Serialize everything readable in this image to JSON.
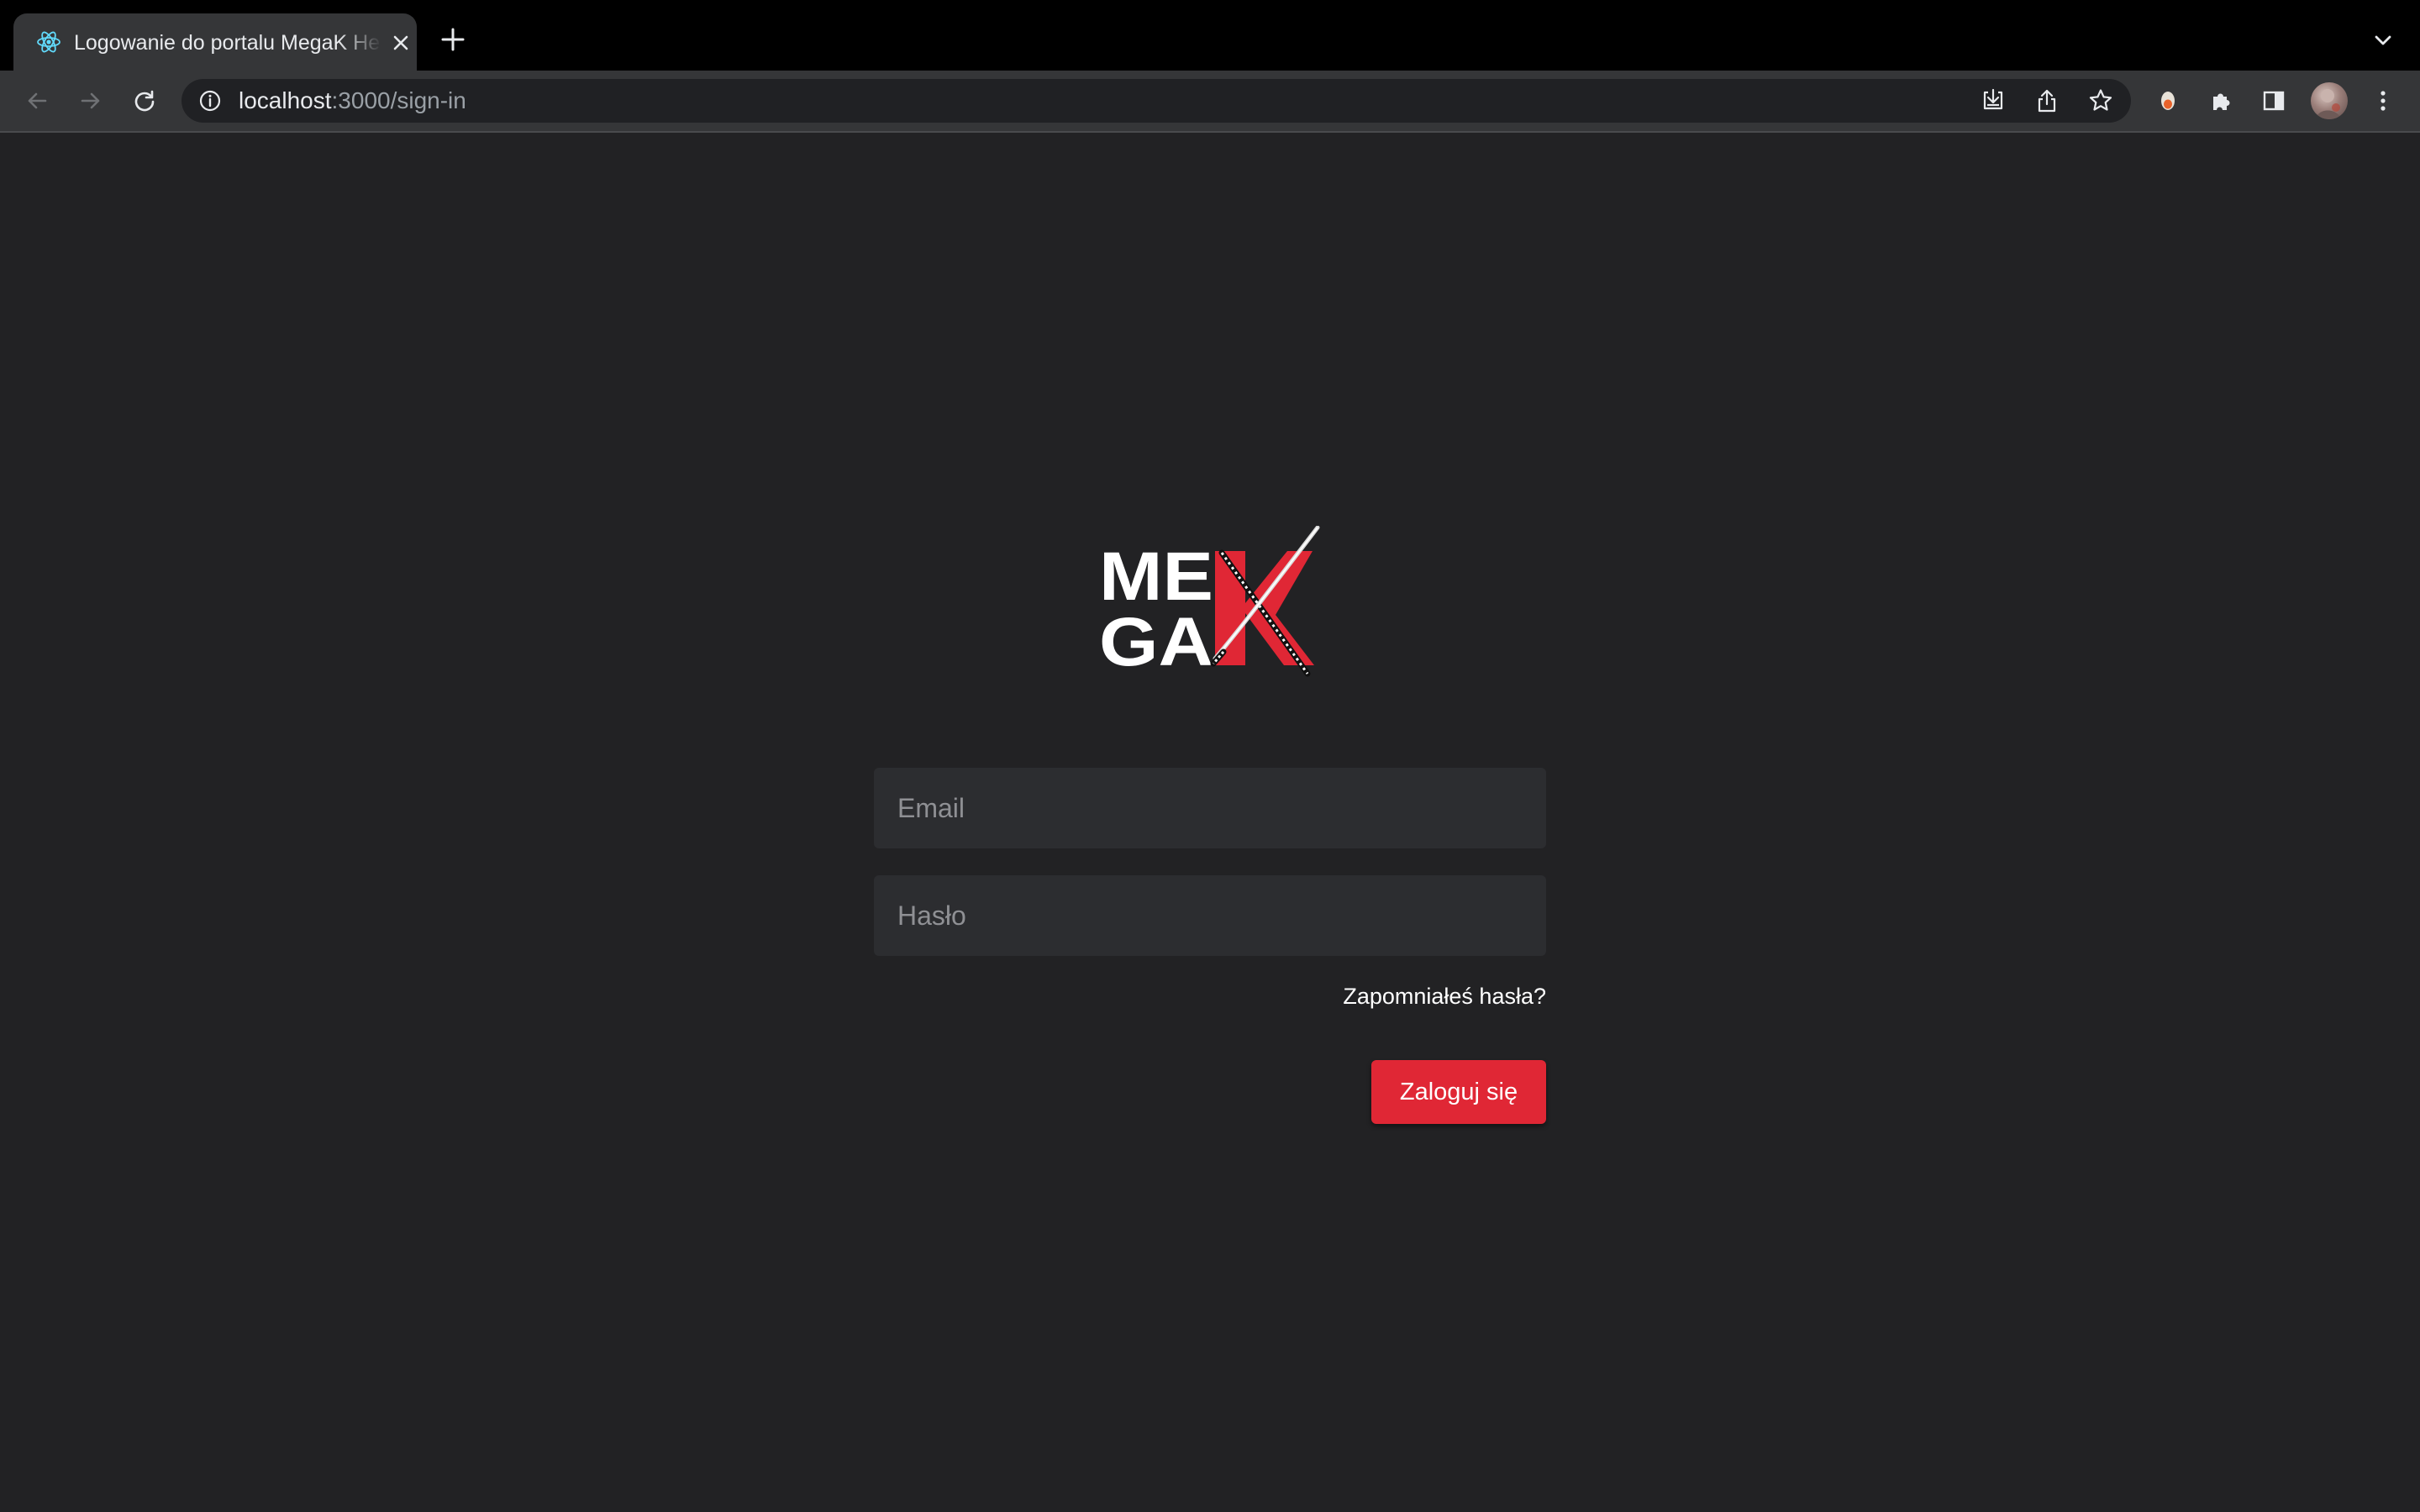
{
  "browser": {
    "tab": {
      "title": "Logowanie do portalu MegaK Hea",
      "favicon": "react-icon"
    },
    "address_bar": {
      "host": "localhost",
      "path": ":3000/sign-in"
    },
    "icons": [
      "back-arrow-icon",
      "forward-arrow-icon",
      "reload-icon",
      "info-icon",
      "install-app-icon",
      "share-icon",
      "bookmark-star-icon",
      "extension-icon",
      "puzzle-extensions-icon",
      "side-panel-icon",
      "profile-avatar",
      "more-menu-icon",
      "tab-list-chevron-icon",
      "new-tab-plus-icon",
      "tab-close-icon"
    ]
  },
  "page": {
    "logo": {
      "line1": "ME",
      "line2": "GA",
      "mark": "K",
      "colors": {
        "text": "#ffffff",
        "mark": "#e02735"
      }
    },
    "form": {
      "email_placeholder": "Email",
      "password_placeholder": "Hasło",
      "forgot_link": "Zapomniałeś hasła?",
      "submit_label": "Zaloguj się"
    }
  },
  "colors": {
    "page_background": "#222224",
    "input_background": "#2c2d30",
    "accent": "#e02735"
  }
}
